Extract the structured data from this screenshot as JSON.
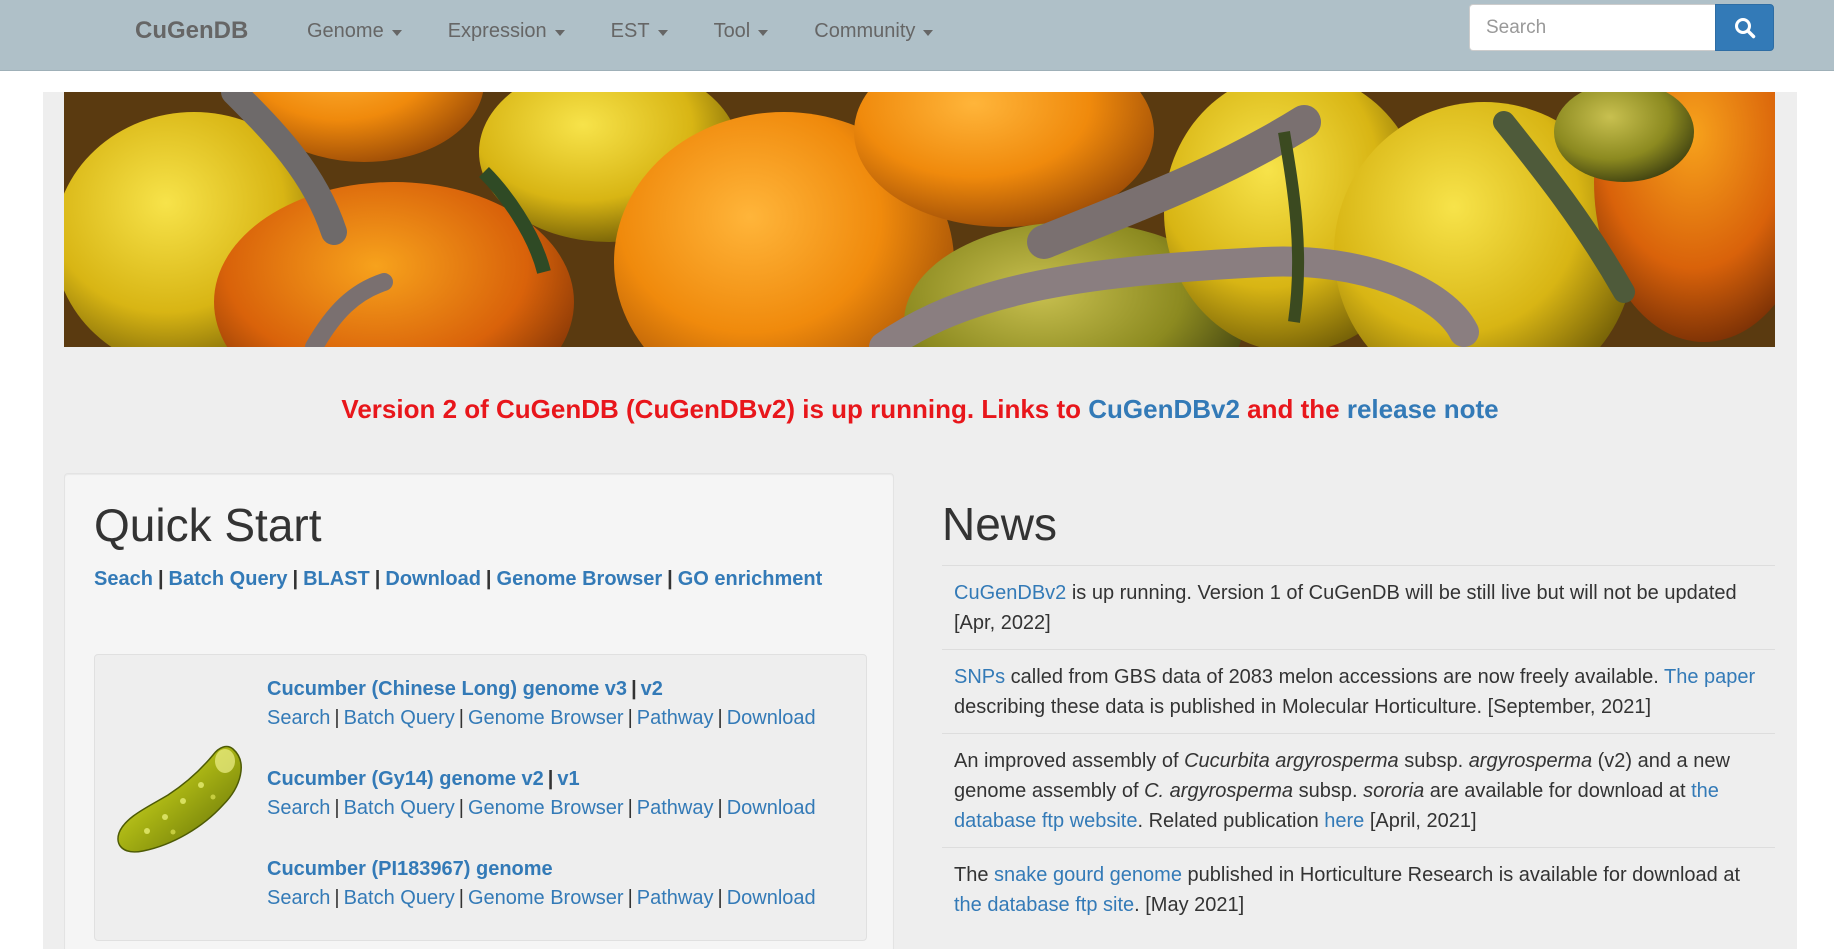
{
  "navbar": {
    "brand": "CuGenDB",
    "menu": [
      {
        "label": "Genome"
      },
      {
        "label": "Expression"
      },
      {
        "label": "EST"
      },
      {
        "label": "Tool"
      },
      {
        "label": "Community"
      }
    ],
    "search_placeholder": "Search",
    "search_icon": "search-icon"
  },
  "announcement": {
    "text1": "Version 2 of CuGenDB (CuGenDBv2) is up running. Links to ",
    "link1": "CuGenDBv2",
    "text2": " and the ",
    "link2": "release note"
  },
  "quick_start": {
    "title": "Quick Start",
    "links": [
      "Seach",
      "Batch Query",
      "BLAST",
      "Download",
      "Genome Browser",
      "GO enrichment"
    ],
    "separator": "|",
    "genomes": [
      {
        "name": "Cucumber (Chinese Long) genome v3",
        "alt": "v2",
        "actions": [
          "Search",
          "Batch Query",
          "Genome Browser",
          "Pathway",
          "Download"
        ]
      },
      {
        "name": "Cucumber (Gy14) genome v2",
        "alt": "v1",
        "actions": [
          "Search",
          "Batch Query",
          "Genome Browser",
          "Pathway",
          "Download"
        ]
      },
      {
        "name": "Cucumber (PI183967) genome",
        "alt": "",
        "actions": [
          "Search",
          "Batch Query",
          "Genome Browser",
          "Pathway",
          "Download"
        ]
      }
    ]
  },
  "news": {
    "title": "News",
    "items": [
      {
        "n1_link": "CuGenDBv2",
        "n1_text": " is up running. Version 1 of CuGenDB will be still live but will not be updated [Apr, 2022]"
      },
      {
        "n2_link1": "SNPs",
        "n2_text1": " called from GBS data of 2083 melon accessions are now freely available. ",
        "n2_link2": "The paper",
        "n2_text2": " describing these data is published in Molecular Horticulture. [September, 2021]"
      },
      {
        "n3_text1": "An improved assembly of ",
        "n3_em1": "Cucurbita argyrosperma",
        "n3_text2": " subsp. ",
        "n3_em2": "argyrosperma",
        "n3_text3": " (v2) and a new genome assembly of ",
        "n3_em3": "C. argyrosperma",
        "n3_text4": " subsp. ",
        "n3_em4": "sororia",
        "n3_text5": " are available for download at ",
        "n3_link1": "the database ftp website",
        "n3_text6": ". Related publication ",
        "n3_link2": "here",
        "n3_text7": " [April, 2021]"
      },
      {
        "n4_text1": "The ",
        "n4_link1": "snake gourd genome",
        "n4_text2": " published in Horticulture Research is available for download at ",
        "n4_link2": "the database ftp site",
        "n4_text3": ". [May 2021]"
      }
    ]
  }
}
